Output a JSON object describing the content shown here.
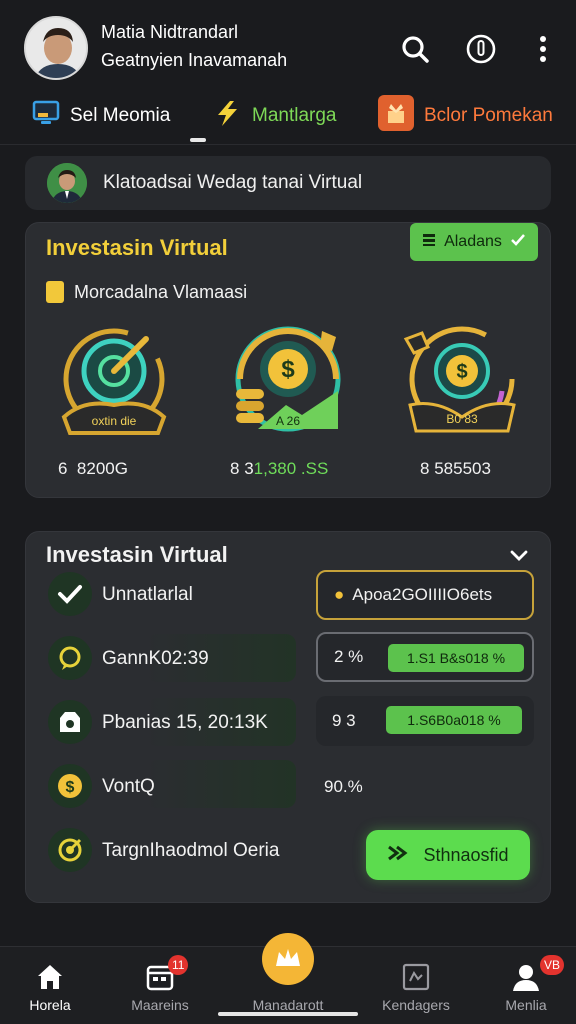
{
  "header": {
    "user_name": "Matia Nidtrandarl",
    "user_sub": "Geatnyien Inavamanah",
    "icons": [
      "search-icon",
      "power-icon",
      "more-vertical-icon"
    ]
  },
  "tabs": [
    {
      "label": "Sel Meomia",
      "icon": "monitor-icon",
      "color": "#ffffff"
    },
    {
      "label": "Mantlarga",
      "icon": "lightning-icon",
      "color": "#7ed957"
    },
    {
      "label": "Bclor Pomekan",
      "icon": "gift-icon",
      "color": "#ff7a3c"
    }
  ],
  "banner": {
    "text": "Klatoadsai Wedag tanai Virtual"
  },
  "card1": {
    "title": "Investasin Virtual",
    "badge": "Aladans",
    "subtitle": "Morcadalna Vlamaasi",
    "items": [
      {
        "icon_label": "oxtin die",
        "value": "8200G",
        "prefix": "6"
      },
      {
        "icon_label": "A 26",
        "value_prefix": "8",
        "value_white": "3",
        "value_green": "1,380 .SS"
      },
      {
        "icon_label": "B0 83",
        "value": "585503",
        "prefix": "8"
      }
    ]
  },
  "card2": {
    "title": "Investasin Virtual",
    "rows": [
      {
        "icon": "check-icon",
        "label": "Unnatlarlal"
      },
      {
        "icon": "chat-icon",
        "label": "GannK02:39"
      },
      {
        "icon": "shop-icon",
        "label": "Pbanias 15, 20:13K"
      },
      {
        "icon": "coin-icon",
        "label": "VontQ"
      },
      {
        "icon": "target-icon",
        "label": "TargnIhaodmol Oeria"
      }
    ],
    "box1": "Apoa2GOIIIIO6ets",
    "box2_left": "2 %",
    "box2_pill": "1.S1 B&s018 %",
    "box3_left": "9 3",
    "box3_pill": "1.S6B0a018 %",
    "row4_value": "90.%",
    "submit": "Sthnaosfid"
  },
  "bottom_nav": [
    {
      "label": "Horela",
      "icon": "home-icon",
      "active": true
    },
    {
      "label": "Maareins",
      "icon": "calendar-icon",
      "badge": "11"
    },
    {
      "label": "Manadarott",
      "icon": "crown-icon"
    },
    {
      "label": "Kendagers",
      "icon": "gallery-icon"
    },
    {
      "label": "Menlia",
      "icon": "user-icon",
      "badge": "VB"
    }
  ],
  "colors": {
    "accent_green": "#5cc24d",
    "accent_gold": "#f2cf3a",
    "background": "#1a1b1e",
    "card": "#2b2d31"
  }
}
